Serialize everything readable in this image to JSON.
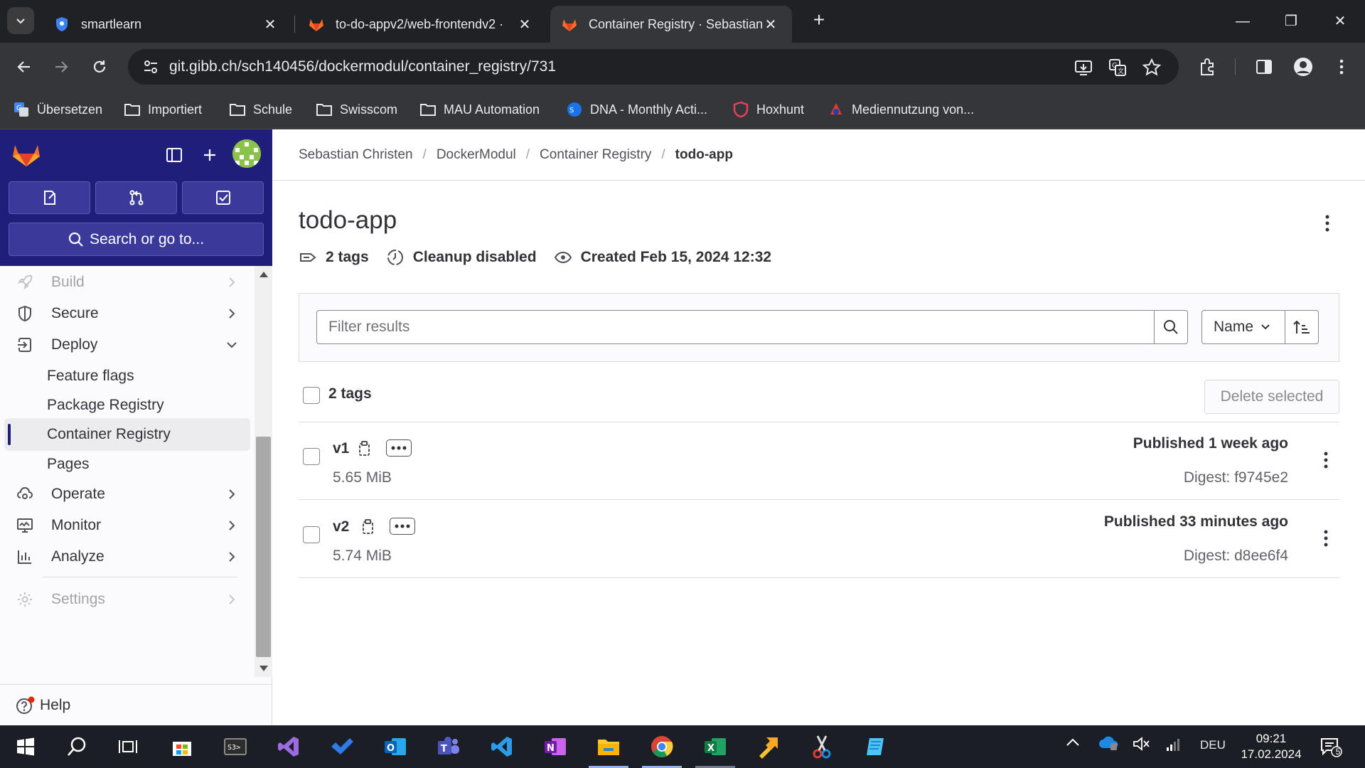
{
  "browser": {
    "tabs": [
      {
        "title": "smartlearn",
        "icon": "smartlearn-shield-icon"
      },
      {
        "title": "to-do-appv2/web-frontendv2 · ",
        "icon": "gitlab-tanuki-icon"
      },
      {
        "title": "Container Registry · Sebastian C",
        "icon": "gitlab-tanuki-icon",
        "active": true
      }
    ],
    "new_tab_label": "+",
    "url": "git.gibb.ch/sch140456/dockermodul/container_registry/731",
    "bookmarks": [
      {
        "label": "Übersetzen",
        "icon": "google-translate-icon"
      },
      {
        "label": "Importiert",
        "icon": "folder-icon"
      },
      {
        "label": "Schule",
        "icon": "folder-icon"
      },
      {
        "label": "Swisscom",
        "icon": "folder-icon"
      },
      {
        "label": "MAU Automation",
        "icon": "folder-icon"
      },
      {
        "label": "DNA - Monthly Acti...",
        "icon": "dna-icon"
      },
      {
        "label": "Hoxhunt",
        "icon": "hoxhunt-shield-icon"
      },
      {
        "label": "Mediennutzung von...",
        "icon": "mediennutzung-icon"
      }
    ]
  },
  "sidebar": {
    "search_label": "Search or go to...",
    "nav": [
      {
        "label": "Build",
        "icon": "rocket-icon",
        "expandable": true,
        "faded": true
      },
      {
        "label": "Secure",
        "icon": "shield-icon",
        "expandable": true
      },
      {
        "label": "Deploy",
        "icon": "deploy-icon",
        "expanded": true
      },
      {
        "label": "Feature flags",
        "sub": true
      },
      {
        "label": "Package Registry",
        "sub": true
      },
      {
        "label": "Container Registry",
        "sub": true,
        "active": true
      },
      {
        "label": "Pages",
        "sub": true
      },
      {
        "label": "Operate",
        "icon": "cloud-gear-icon",
        "expandable": true
      },
      {
        "label": "Monitor",
        "icon": "monitor-icon",
        "expandable": true
      },
      {
        "label": "Analyze",
        "icon": "chart-icon",
        "expandable": true
      },
      {
        "label": "Settings",
        "icon": "gear-icon",
        "expandable": true,
        "faded": true
      }
    ],
    "help_label": "Help"
  },
  "breadcrumb": [
    "Sebastian Christen",
    "DockerModul",
    "Container Registry",
    "todo-app"
  ],
  "page": {
    "title": "todo-app",
    "meta": {
      "tags": "2 tags",
      "cleanup": "Cleanup disabled",
      "created": "Created Feb 15, 2024 12:32"
    },
    "filter_placeholder": "Filter results",
    "sort_label": "Name",
    "list_header": "2 tags",
    "delete_selected": "Delete selected",
    "tags": [
      {
        "name": "v1",
        "size": "5.65 MiB",
        "published_prefix": "Published ",
        "published_time": "1 week ago",
        "digest": "Digest: f9745e2"
      },
      {
        "name": "v2",
        "size": "5.74 MiB",
        "published_prefix": "Published ",
        "published_time": "33 minutes ago",
        "digest": "Digest: d8ee6f4"
      }
    ]
  },
  "taskbar": {
    "tray_lang": "DEU",
    "time": "09:21",
    "date": "17.02.2024",
    "notifications": "5",
    "apps": [
      "start-icon",
      "search-icon",
      "task-view-icon",
      "microsoft-store-icon",
      "terminal-icon",
      "visual-studio-icon",
      "todo-icon",
      "outlook-icon",
      "teams-icon",
      "vscode-icon",
      "onenote-icon",
      "file-explorer-icon",
      "chrome-icon",
      "excel-icon",
      "app-icon",
      "snipping-tool-icon",
      "notepad-icon"
    ]
  },
  "colors": {
    "gitlab_sidebar_top": "#1f1e7a",
    "chrome_dark": "#202124",
    "gitlab_orange": "#fc6d26"
  }
}
